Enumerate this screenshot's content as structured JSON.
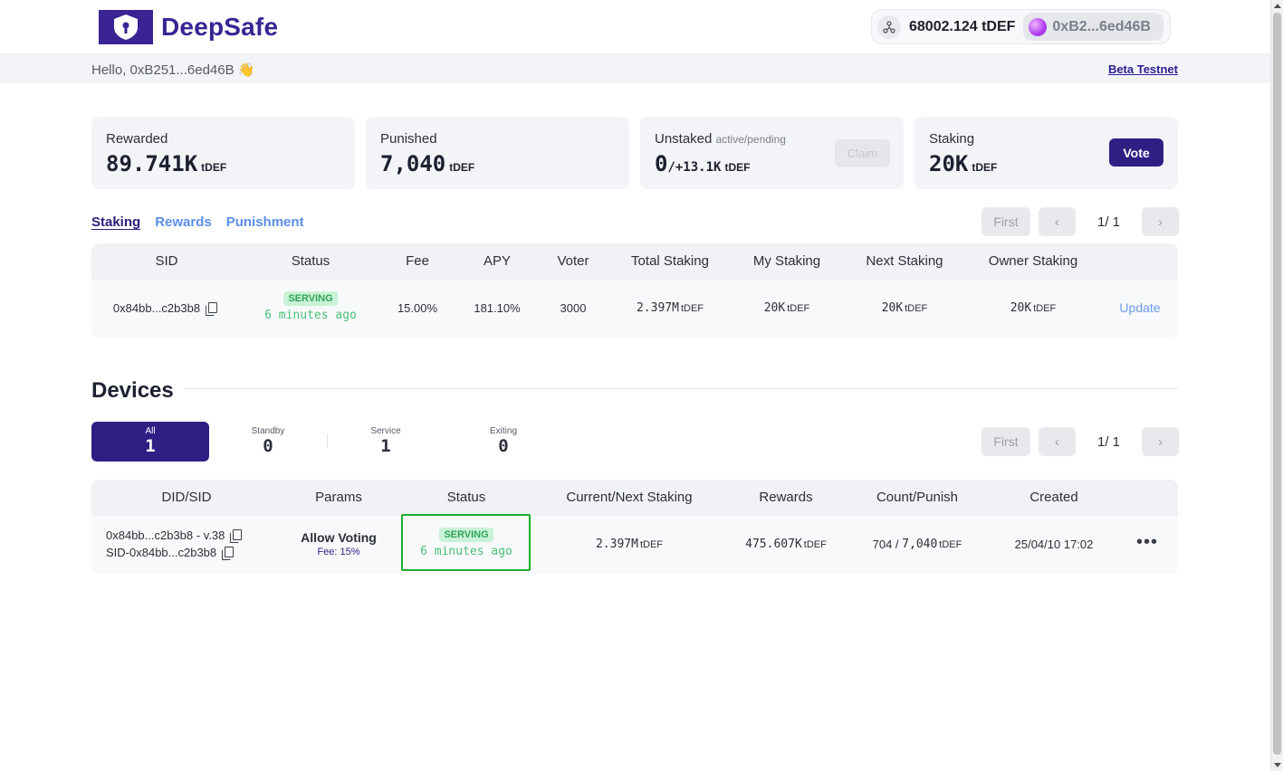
{
  "header": {
    "logo_text": "DeepSafe",
    "balance": "68002.124 tDEF",
    "address": "0xB2...6ed46B"
  },
  "subbar": {
    "greeting": "Hello, 0xB251...6ed46B 👋",
    "network_link": "Beta Testnet"
  },
  "cards": {
    "rewarded": {
      "title": "Rewarded",
      "value": "89.741K",
      "unit": "tDEF"
    },
    "punished": {
      "title": "Punished",
      "value": "7,040",
      "unit": "tDEF"
    },
    "unstaked": {
      "title": "Unstaked",
      "subtitle": "active/pending",
      "value": "0",
      "extra": "/+13.1K",
      "unit": "tDEF",
      "claim_label": "Claim"
    },
    "staking": {
      "title": "Staking",
      "value": "20K",
      "unit": "tDEF",
      "vote_label": "Vote"
    }
  },
  "tabs": [
    {
      "label": "Staking",
      "active": true
    },
    {
      "label": "Rewards",
      "active": false
    },
    {
      "label": "Punishment",
      "active": false
    }
  ],
  "pager": {
    "first_label": "First",
    "prev_icon": "chevron-left-icon",
    "next_icon": "chevron-right-icon",
    "page_text": "1/ 1"
  },
  "staking_table": {
    "columns": [
      "SID",
      "Status",
      "Fee",
      "APY",
      "Voter",
      "Total Staking",
      "My Staking",
      "Next Staking",
      "Owner Staking"
    ],
    "rows": [
      {
        "sid": "0x84bb...c2b3b8",
        "status_badge": "SERVING",
        "status_time": "6 minutes ago",
        "fee": "15.00%",
        "apy": "181.10%",
        "voter": "3000",
        "total_staking": "2.397M",
        "my_staking": "20K",
        "next_staking": "20K",
        "owner_staking": "20K",
        "unit": "tDEF",
        "action": "Update"
      }
    ]
  },
  "devices": {
    "title": "Devices",
    "filters": [
      {
        "label": "All",
        "count": "1",
        "active": true
      },
      {
        "label": "Standby",
        "count": "0",
        "active": false
      },
      {
        "label": "Service",
        "count": "1",
        "active": false
      },
      {
        "label": "Exiting",
        "count": "0",
        "active": false
      }
    ],
    "columns": [
      "DID/SID",
      "Params",
      "Status",
      "Current/Next Staking",
      "Rewards",
      "Count/Punish",
      "Created"
    ],
    "rows": [
      {
        "did": "0x84bb...c2b3b8 - v.38",
        "sid": "SID-0x84bb...c2b3b8",
        "params_title": "Allow Voting",
        "params_fee": "Fee: 15%",
        "status_badge": "SERVING",
        "status_time": "6 minutes ago",
        "staking": "2.397M",
        "rewards": "475.607K",
        "count": "704 / ",
        "punish": "7,040",
        "unit": "tDEF",
        "created": "25/04/10 17:02",
        "menu_icon": "more-horizontal-icon"
      }
    ]
  },
  "colors": {
    "brand": "#3a2494",
    "vote_button": "#2e1f85",
    "tab_link": "#5b8fe8",
    "serving_green": "#32a35a",
    "highlight_box": "#1fae2d"
  }
}
